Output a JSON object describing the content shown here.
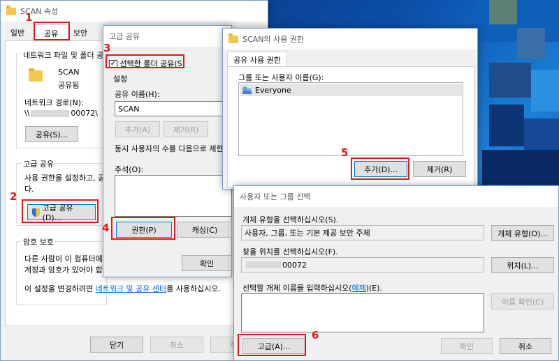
{
  "colors": {
    "accent_red": "#e01a1a",
    "link_blue": "#0066cc",
    "desktop_blue": "#0b4ea8"
  },
  "steps": [
    "1",
    "2",
    "3",
    "4",
    "5",
    "6"
  ],
  "scan_window": {
    "title": "SCAN 속성",
    "tabs": [
      "일반",
      "공유",
      "보안"
    ],
    "network_section_title": "네트워크 파일 및 폴더 공",
    "folder_name": "SCAN",
    "folder_status": "공유됨",
    "network_path_label": "네트워크 경로(N):",
    "network_path_prefix": "\\\\",
    "network_path_suffix": "00072\\",
    "share_button": "공유(S)...",
    "advanced_section_title": "고급 공유",
    "advanced_desc_line1": "사용 권한을 설정하고, 공",
    "advanced_desc_line2": "다.",
    "advanced_share_button": "고급 공유(D)...",
    "password_section_title": "암호 보호",
    "password_desc_line1": "다른 사람이 이 컴퓨터에",
    "password_desc_line2": "계정과 암호가 있어야 합",
    "change_text_prefix": "이 설정을 변경하려면 ",
    "change_link": "네트워크 및 공유 센터",
    "change_text_suffix": "를 사용하십시오.",
    "close_button": "닫기",
    "cancel_button": "취소",
    "apply_button": "적용"
  },
  "advanced_window": {
    "title": "고급 공유",
    "share_checkbox_label": "선택한 폴더 공유(S)",
    "settings_label": "설정",
    "share_name_label": "공유 이름(H):",
    "share_name_value": "SCAN",
    "add_button": "추가(A)",
    "remove_button": "제거(R)",
    "limit_text": "동시 사용자의 수를 다음으로 제한",
    "comment_label": "주석(O):",
    "permissions_button": "권한(P)",
    "caching_button": "캐싱(C)",
    "ok_button": "확인"
  },
  "permissions_window": {
    "title": "SCAN의 사용 권한",
    "tab_label": "공유 사용 권한",
    "group_label": "그룹 또는 사용자 이름(G):",
    "users": [
      "Everyone"
    ],
    "add_button": "추가(D)...",
    "remove_button": "제거(R)"
  },
  "select_window": {
    "title": "사용자 또는 그룹 선택",
    "object_type_label": "개체 유형을 선택하십시오(S).",
    "object_type_value": "사용자, 그룹, 또는 기본 제공 보안 주체",
    "object_type_button": "개체 유형(O)...",
    "location_label": "찾을 위치를 선택하십시오(F).",
    "location_value": "00072",
    "location_button": "위치(L)...",
    "names_label_prefix": "선택할 개체 이름을 입력하십시오(",
    "names_label_link": "예제",
    "names_label_suffix": ")(E).",
    "check_names_button": "이름 확인(C)",
    "advanced_button": "고급(A)...",
    "ok_button": "확인",
    "cancel_button": "취소"
  }
}
